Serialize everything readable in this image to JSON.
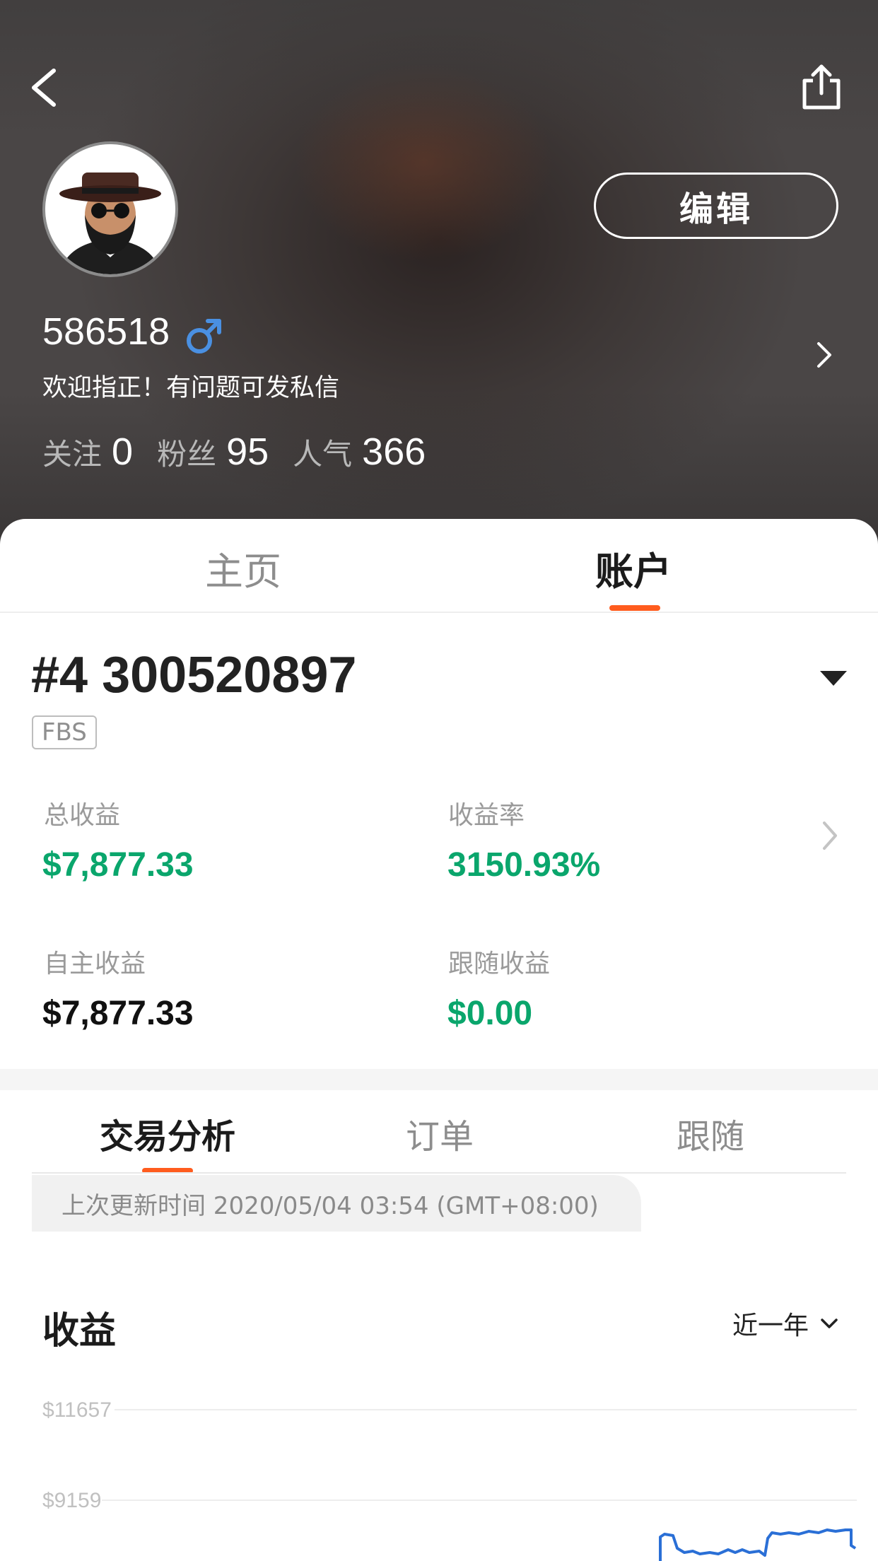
{
  "header": {
    "username": "586518",
    "bio": "欢迎指正！有问题可发私信",
    "edit_label": "编辑",
    "gender_color": "#4a90e2",
    "stats": [
      {
        "label": "关注",
        "value": "0"
      },
      {
        "label": "粉丝",
        "value": "95"
      },
      {
        "label": "人气",
        "value": "366"
      }
    ]
  },
  "tabs": {
    "home": "主页",
    "account": "账户",
    "active": "账户",
    "accent": "#ff5c1e"
  },
  "account": {
    "number": "#4 300520897",
    "broker": "FBS",
    "metrics": {
      "total_profit_label": "总收益",
      "total_profit": "$7,877.33",
      "return_rate_label": "收益率",
      "return_rate": "3150.93%",
      "own_profit_label": "自主收益",
      "own_profit": "$7,877.33",
      "follow_profit_label": "跟随收益",
      "follow_profit": "$0.00"
    },
    "positive_color": "#0aa66c"
  },
  "sub_tabs": {
    "items": [
      "交易分析",
      "订单",
      "跟随"
    ],
    "active": "交易分析"
  },
  "update_text": "上次更新时间 2020/05/04 03:54 (GMT+08:00)",
  "chart_section": {
    "title": "收益",
    "range": "近一年"
  },
  "chart_data": {
    "type": "line",
    "y_ticks": [
      "$11657",
      "$9159"
    ],
    "series_color": "#2a6fd6",
    "grid": true
  }
}
